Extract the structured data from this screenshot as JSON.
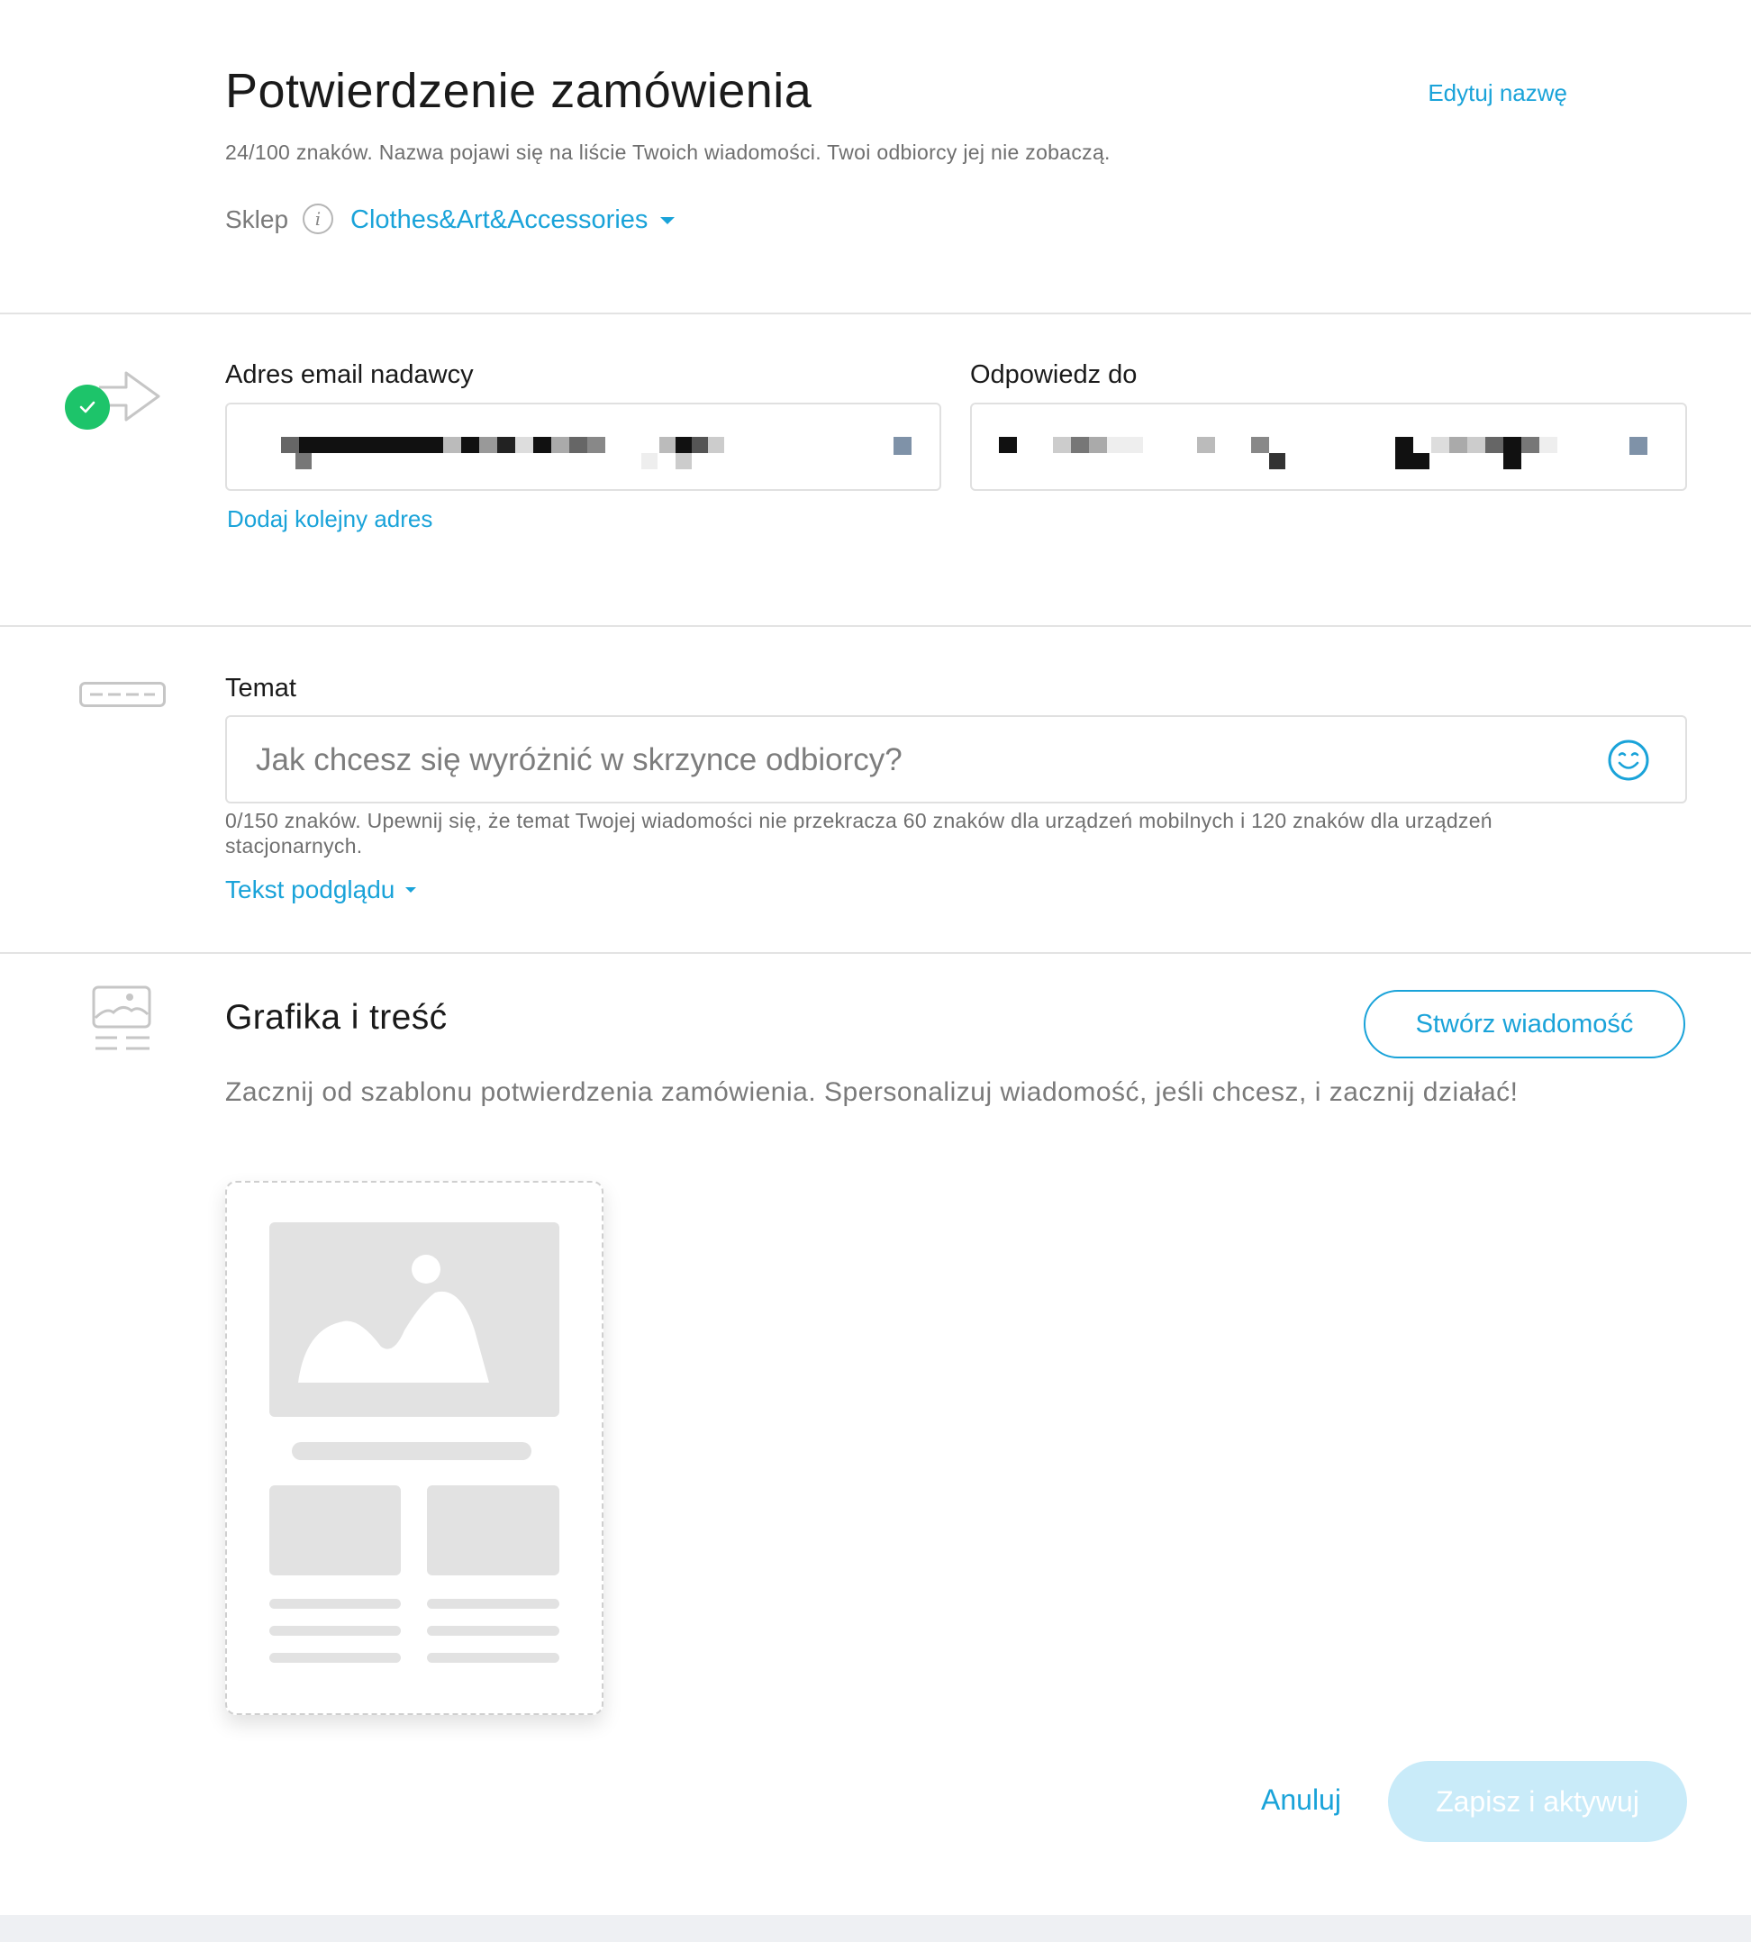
{
  "header": {
    "title": "Potwierdzenie zamówienia",
    "edit_name_label": "Edytuj nazwę",
    "name_hint": "24/100 znaków. Nazwa pojawi się na liście Twoich wiadomości. Twoi odbiorcy jej nie zobaczą.",
    "store_label": "Sklep",
    "store_value": "Clothes&Art&Accessories"
  },
  "sender": {
    "from_label": "Adres email nadawcy",
    "reply_label": "Odpowiedz do",
    "add_address_label": "Dodaj kolejny adres",
    "status_color": "#1dc46a"
  },
  "subject": {
    "label": "Temat",
    "placeholder": "Jak chcesz się wyróżnić w skrzynce odbiorcy?",
    "hint": "0/150 znaków. Upewnij się, że temat Twojej wiadomości nie przekracza 60 znaków dla urządzeń mobilnych i 120 znaków dla urządzeń stacjonarnych.",
    "preview_text_label": "Tekst podglądu"
  },
  "content": {
    "title": "Grafika i treść",
    "create_button": "Stwórz wiadomość",
    "description": "Zacznij od szablonu potwierdzenia zamówienia. Spersonalizuj wiadomość, jeśli chcesz, i zacznij działać!"
  },
  "footer": {
    "cancel_label": "Anuluj",
    "save_label": "Zapisz i aktywuj"
  },
  "colors": {
    "accent": "#1aa3d9",
    "success": "#1dc46a",
    "save_disabled": "#c9ebf9"
  }
}
